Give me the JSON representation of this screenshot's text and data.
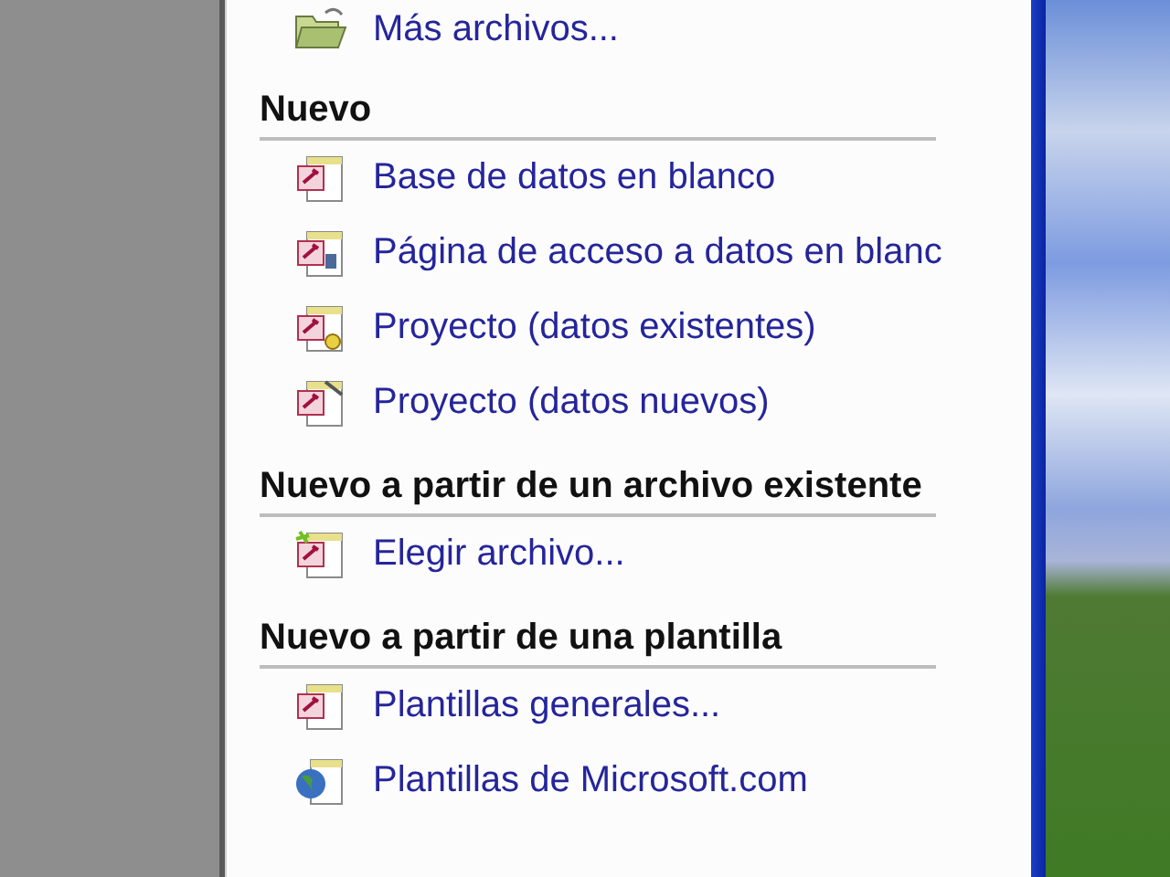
{
  "top_item": {
    "label": "Más archivos...",
    "kind": "folder"
  },
  "sections": [
    {
      "heading": "Nuevo",
      "items": [
        {
          "label": "Base de datos en blanco",
          "kind": "database"
        },
        {
          "label": "Página de acceso a datos en blanc",
          "kind": "data-page"
        },
        {
          "label": "Proyecto (datos existentes)",
          "kind": "project-existing"
        },
        {
          "label": "Proyecto (datos nuevos)",
          "kind": "project-new"
        }
      ]
    },
    {
      "heading": "Nuevo a partir de un archivo existente",
      "items": [
        {
          "label": "Elegir archivo...",
          "kind": "choose-file"
        }
      ]
    },
    {
      "heading": "Nuevo a partir de una plantilla",
      "items": [
        {
          "label": "Plantillas generales...",
          "kind": "template"
        },
        {
          "label": "Plantillas de Microsoft.com",
          "kind": "web"
        }
      ]
    }
  ]
}
